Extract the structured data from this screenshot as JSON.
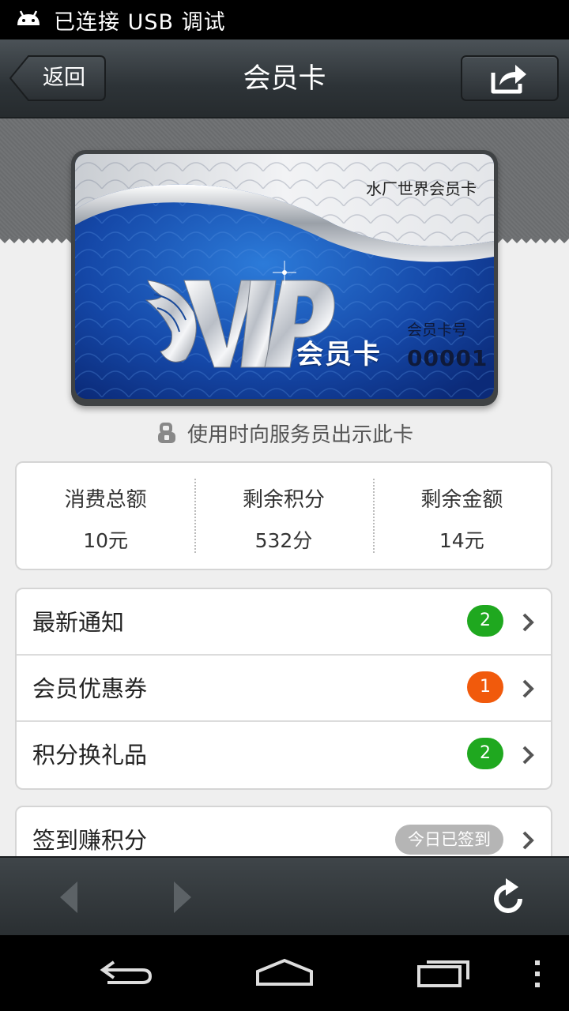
{
  "status_bar": {
    "text": "已连接 USB 调试",
    "icon": "android-debug-icon"
  },
  "header": {
    "back_label": "返回",
    "title": "会员卡",
    "share_icon": "share-icon"
  },
  "card": {
    "brand": "水厂世界会员卡",
    "logo_text": "VIP",
    "label": "会员卡",
    "number_label": "会员卡号",
    "number": "00001"
  },
  "hint": {
    "text": "使用时向服务员出示此卡",
    "icon": "waiter-icon"
  },
  "stats": [
    {
      "label": "消费总额",
      "value": "10元"
    },
    {
      "label": "剩余积分",
      "value": "532分"
    },
    {
      "label": "剩余金额",
      "value": "14元"
    }
  ],
  "menu": [
    {
      "label": "最新通知",
      "badge": "2",
      "badge_color": "#1fa81f"
    },
    {
      "label": "会员优惠券",
      "badge": "1",
      "badge_color": "#f15a0c"
    },
    {
      "label": "积分换礼品",
      "badge": "2",
      "badge_color": "#1fa81f"
    }
  ],
  "checkin": {
    "label": "签到赚积分",
    "status": "今日已签到"
  },
  "toolbar": {
    "back_icon": "arrow-left-icon",
    "forward_icon": "arrow-right-icon",
    "refresh_icon": "refresh-icon"
  },
  "navbar": {
    "back_icon": "nav-back-icon",
    "home_icon": "nav-home-icon",
    "recents_icon": "nav-recents-icon",
    "menu_icon": "overflow-menu-icon"
  }
}
